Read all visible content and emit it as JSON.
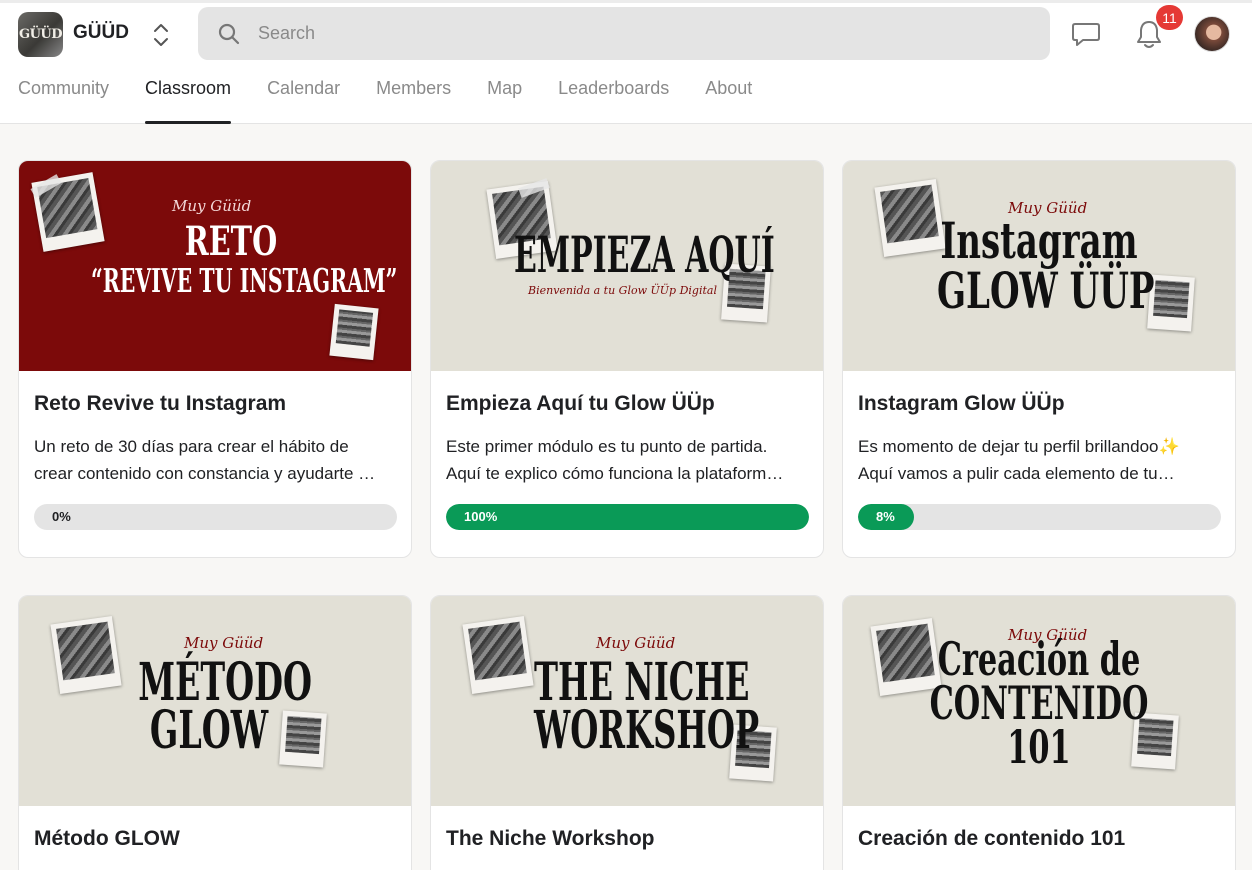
{
  "app": {
    "brand": "GÜÜD",
    "logo_text": "GÜÜD"
  },
  "search": {
    "placeholder": "Search"
  },
  "header": {
    "notifications_count": "11"
  },
  "tabs": [
    {
      "label": "Community"
    },
    {
      "label": "Classroom",
      "active": true
    },
    {
      "label": "Calendar"
    },
    {
      "label": "Members"
    },
    {
      "label": "Map"
    },
    {
      "label": "Leaderboards"
    },
    {
      "label": "About"
    }
  ],
  "colors": {
    "accent_green": "#0a9a57",
    "badge_red": "#e53935",
    "cover_red": "#7c0a0a",
    "cover_beige": "#e2e0d6"
  },
  "courses": [
    {
      "title": "Reto Revive tu Instagram",
      "desc_line1": "Un reto de 30 días para crear el hábito de",
      "desc_line2": "crear contenido con constancia y ayudarte …",
      "progress": 0,
      "progress_label": "0%",
      "cover": {
        "script": "Muy Güüd",
        "line1": "RETO",
        "line2": "“REVIVE TU INSTAGRAM”"
      }
    },
    {
      "title": "Empieza Aquí tu Glow ÜÜp",
      "desc_line1": "Este primer módulo es tu punto de partida.",
      "desc_line2": "Aquí te explico cómo funciona la plataform…",
      "progress": 100,
      "progress_label": "100%",
      "cover": {
        "line1": "EMPIEZA AQUÍ",
        "subscript": "Bienvenida a tu Glow ÜÜp Digital"
      }
    },
    {
      "title": "Instagram Glow ÜÜp",
      "desc_line1": "Es momento de dejar tu perfil brillandoo✨",
      "desc_line2": "Aquí vamos a pulir cada elemento de tu…",
      "progress": 8,
      "progress_label": "8%",
      "cover": {
        "script": "Muy Güüd",
        "line1": "Instagram",
        "line2": "GLOW ÜÜP"
      }
    },
    {
      "title": "Método GLOW",
      "cover": {
        "script": "Muy Güüd",
        "line1": "MÉTODO",
        "line2": "GLOW"
      }
    },
    {
      "title": "The Niche Workshop",
      "cover": {
        "script": "Muy Güüd",
        "line1": "THE NICHE",
        "line2": "WORKSHOP"
      }
    },
    {
      "title": "Creación de contenido 101",
      "cover": {
        "script": "Muy Güüd",
        "line1": "Creación de",
        "line2": "CONTENIDO",
        "line3": "101"
      }
    }
  ]
}
